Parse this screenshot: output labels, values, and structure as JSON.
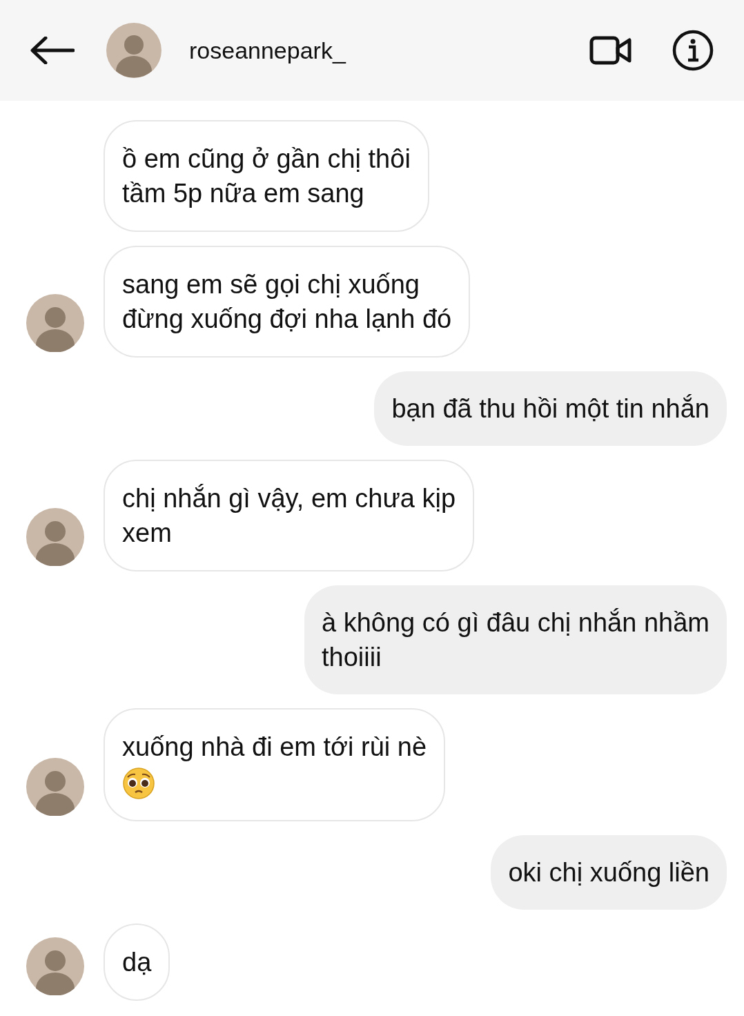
{
  "header": {
    "username": "roseannepark_"
  },
  "messages": [
    {
      "kind": "incoming",
      "text": "ồ em cũng ở gần chị thôi\ntầm 5p nữa em sang",
      "emoji": false,
      "show_avatar": false
    },
    {
      "kind": "incoming",
      "text": "sang em sẽ gọi chị xuống\nđừng xuống đợi nha lạnh đó",
      "emoji": false,
      "show_avatar": true
    },
    {
      "kind": "outgoing",
      "text": "bạn đã thu hồi một tin nhắn",
      "emoji": false
    },
    {
      "kind": "incoming",
      "text": "chị nhắn gì vậy, em chưa kịp\nxem",
      "emoji": false,
      "show_avatar": true
    },
    {
      "kind": "outgoing",
      "text": "à không có gì đâu chị nhắn nhầm\nthoiiii",
      "emoji": false
    },
    {
      "kind": "incoming",
      "text": "xuống nhà đi em tới rùi nè",
      "emoji": true,
      "show_avatar": true
    },
    {
      "kind": "outgoing",
      "text": "oki chị xuống liền",
      "emoji": false
    },
    {
      "kind": "incoming",
      "text": "dạ",
      "emoji": false,
      "show_avatar": true
    }
  ]
}
